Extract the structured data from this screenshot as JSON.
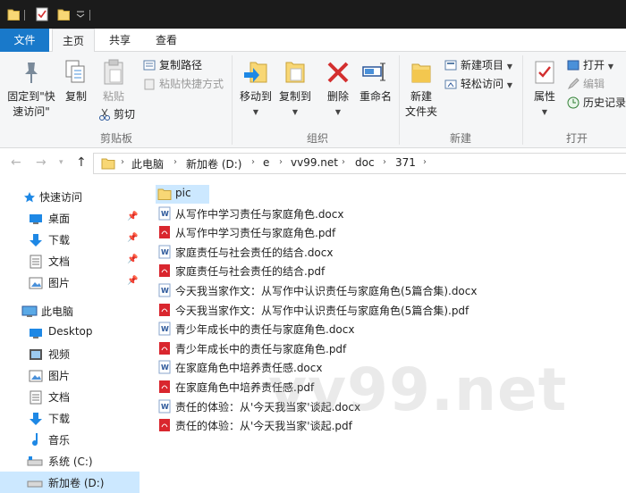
{
  "ribbon_tabs": [
    "文件",
    "主页",
    "共享",
    "查看"
  ],
  "ribbon": {
    "pin_quick_access": "固定到\"快\n速访问\"",
    "copy": "复制",
    "paste": "粘贴",
    "copy_path": "复制路径",
    "paste_shortcut": "粘贴快捷方式",
    "cut": "剪切",
    "clipboard_group": "剪贴板",
    "move_to": "移动到",
    "copy_to": "复制到",
    "delete": "删除",
    "rename": "重命名",
    "organize_group": "组织",
    "new_folder": "新建\n文件夹",
    "new_item": "新建项目",
    "easy_access": "轻松访问",
    "new_group": "新建",
    "properties": "属性",
    "open": "打开",
    "edit": "编辑",
    "history": "历史记录",
    "open_group": "打开"
  },
  "breadcrumbs": [
    "此电脑",
    "新加卷 (D:)",
    "e",
    "vv99.net",
    "doc",
    "371"
  ],
  "nav_pane": {
    "quick_access": "快速访问",
    "quick_items": [
      "桌面",
      "下载",
      "文档",
      "图片"
    ],
    "this_pc": "此电脑",
    "pc_items": [
      "Desktop",
      "视频",
      "图片",
      "文档",
      "下载",
      "音乐",
      "系统 (C:)",
      "新加卷 (D:)"
    ]
  },
  "files": [
    {
      "name": "pic",
      "type": "folder"
    },
    {
      "name": "从写作中学习责任与家庭角色.docx",
      "type": "docx"
    },
    {
      "name": "从写作中学习责任与家庭角色.pdf",
      "type": "pdf"
    },
    {
      "name": "家庭责任与社会责任的结合.docx",
      "type": "docx"
    },
    {
      "name": "家庭责任与社会责任的结合.pdf",
      "type": "pdf"
    },
    {
      "name": "今天我当家作文：从写作中认识责任与家庭角色(5篇合集).docx",
      "type": "docx"
    },
    {
      "name": "今天我当家作文：从写作中认识责任与家庭角色(5篇合集).pdf",
      "type": "pdf"
    },
    {
      "name": "青少年成长中的责任与家庭角色.docx",
      "type": "docx"
    },
    {
      "name": "青少年成长中的责任与家庭角色.pdf",
      "type": "pdf"
    },
    {
      "name": "在家庭角色中培养责任感.docx",
      "type": "docx"
    },
    {
      "name": "在家庭角色中培养责任感.pdf",
      "type": "pdf"
    },
    {
      "name": "责任的体验：从'今天我当家'谈起.docx",
      "type": "docx"
    },
    {
      "name": "责任的体验：从'今天我当家'谈起.pdf",
      "type": "pdf"
    }
  ],
  "watermark": "vv99.net",
  "colors": {
    "accent": "#1979ca",
    "selection": "#cce8ff",
    "folder": "#f8d775",
    "pdf": "#d9262e",
    "word": "#2b579a",
    "delete": "#d32f2f"
  }
}
